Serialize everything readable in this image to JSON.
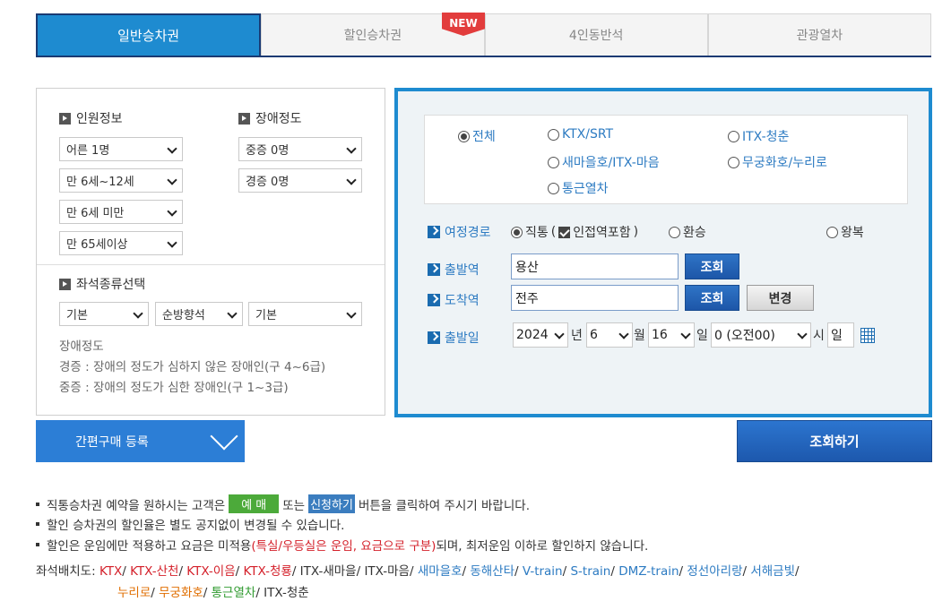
{
  "tabs": [
    {
      "label": "일반승차권",
      "active": true
    },
    {
      "label": "할인승차권",
      "active": false
    },
    {
      "label": "4인동반석",
      "active": false
    },
    {
      "label": "관광열차",
      "active": false
    }
  ],
  "new_badge": "NEW",
  "passenger": {
    "heading": "인원정보",
    "adult": "어른 1명",
    "child": "만 6세~12세",
    "infant": "만 6세 미만",
    "senior": "만 65세이상"
  },
  "disability": {
    "heading": "장애정도",
    "severe": "중증 0명",
    "mild": "경증 0명"
  },
  "seat_type": {
    "heading": "좌석종류선택",
    "sel1": "기본",
    "sel2": "순방향석",
    "sel3": "기본"
  },
  "disability_notes": {
    "title": "장애정도",
    "mild": "경증 : 장애의 정도가 심하지 않은 장애인(구 4~6급)",
    "severe": "중증 : 장애의 정도가 심한 장애인(구 1~3급)"
  },
  "train_types": [
    {
      "label": "전체",
      "checked": true
    },
    {
      "label": "KTX/SRT",
      "checked": false
    },
    {
      "label": "ITX-청춘",
      "checked": false
    },
    {
      "label": "새마을호/ITX-마음",
      "checked": false
    },
    {
      "label": "무궁화호/누리로",
      "checked": false
    },
    {
      "label": "통근열차",
      "checked": false
    }
  ],
  "route": {
    "label": "여정경로",
    "direct": "직통",
    "adjacent": "인접역포함",
    "transfer": "환승",
    "roundtrip": "왕복"
  },
  "departure": {
    "label": "출발역",
    "value": "용산",
    "search_btn": "조회"
  },
  "arrival": {
    "label": "도착역",
    "value": "전주",
    "search_btn": "조회",
    "swap_btn": "변경"
  },
  "date": {
    "label": "출발일",
    "year": "2024",
    "year_unit": "년",
    "month": "6",
    "month_unit": "월",
    "day": "16",
    "day_unit": "일",
    "hour": "0 (오전00)",
    "hour_unit": "시",
    "weekday": "일"
  },
  "simple_buy": "간편구매 등록",
  "search_button": "조회하기",
  "notes": {
    "n1_a": "직통승차권 예약을 원하시는 고객은",
    "n1_badge1": "예 매",
    "n1_b": "또는",
    "n1_badge2": "신청하기",
    "n1_c": "버튼을 클릭하여 주시기 바랍니다.",
    "n2": "할인 승차권의 할인율은 별도 공지없이 변경될 수 있습니다.",
    "n3_a": "할인은 운임에만 적용하고 요금은 미적용",
    "n3_red": "(특실/우등실은 운임, 요금으로 구분)",
    "n3_b": "되며, 최저운임 이하로 할인하지 않습니다."
  },
  "seat_map": {
    "label": "좌석배치도:",
    "line1": [
      {
        "text": "KTX",
        "color": "red"
      },
      {
        "text": "KTX-산천",
        "color": "red"
      },
      {
        "text": "KTX-이음",
        "color": "red"
      },
      {
        "text": "KTX-청룡",
        "color": "red"
      },
      {
        "text": "ITX-새마을",
        "color": "gray"
      },
      {
        "text": "ITX-마음",
        "color": "gray"
      },
      {
        "text": "새마을호",
        "color": "blue"
      },
      {
        "text": "동해산타",
        "color": "blue"
      },
      {
        "text": "V-train",
        "color": "blue"
      },
      {
        "text": "S-train",
        "color": "blue"
      },
      {
        "text": "DMZ-train",
        "color": "blue"
      },
      {
        "text": "정선아리랑",
        "color": "blue"
      },
      {
        "text": "서해금빛",
        "color": "blue"
      }
    ],
    "line2": [
      {
        "text": "누리로",
        "color": "orange"
      },
      {
        "text": "무궁화호",
        "color": "orange"
      },
      {
        "text": "통근열차",
        "color": "green"
      },
      {
        "text": "ITX-청춘",
        "color": "gray"
      }
    ]
  }
}
